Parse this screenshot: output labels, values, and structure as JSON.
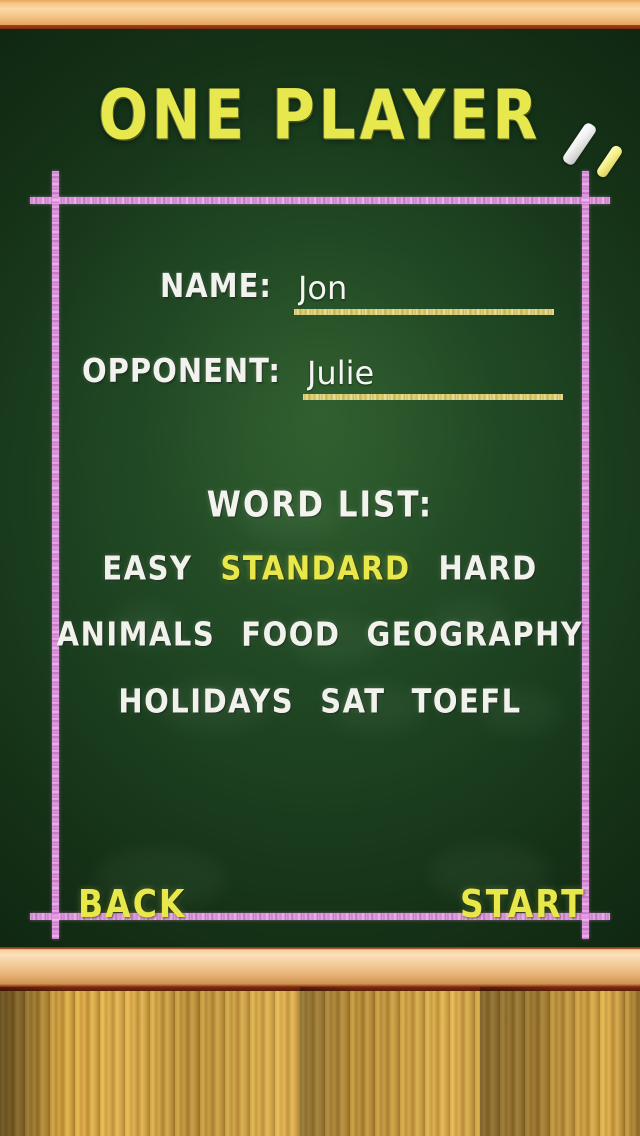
{
  "screen": {
    "title": "ONE PLAYER"
  },
  "decor": {
    "chalk_white": "white-chalk-stick",
    "chalk_yellow": "yellow-chalk-stick",
    "colors": {
      "board_green": "#1d4020",
      "chalk_yellow": "#e8e84a",
      "chalk_white": "#f2f2ec",
      "frame_pink": "#e09ce0",
      "underline_yellow": "#d6c659",
      "wood_light": "#f1c894",
      "wood_floor": "#c79338"
    }
  },
  "form": {
    "name": {
      "label": "NAME:",
      "value": "Jon",
      "placeholder": "Name"
    },
    "opponent": {
      "label": "OPPONENT:",
      "value": "Julie",
      "placeholder": "Opponent"
    }
  },
  "word_list": {
    "title": "WORD LIST:",
    "selected": "STANDARD",
    "rows": [
      [
        {
          "label": "EASY",
          "selected": false
        },
        {
          "label": "STANDARD",
          "selected": true
        },
        {
          "label": "HARD",
          "selected": false
        }
      ],
      [
        {
          "label": "ANIMALS",
          "selected": false
        },
        {
          "label": "FOOD",
          "selected": false
        },
        {
          "label": "GEOGRAPHY",
          "selected": false
        }
      ],
      [
        {
          "label": "HOLIDAYS",
          "selected": false
        },
        {
          "label": "SAT",
          "selected": false
        },
        {
          "label": "TOEFL",
          "selected": false
        }
      ]
    ]
  },
  "actions": {
    "back": "BACK",
    "start": "START"
  }
}
